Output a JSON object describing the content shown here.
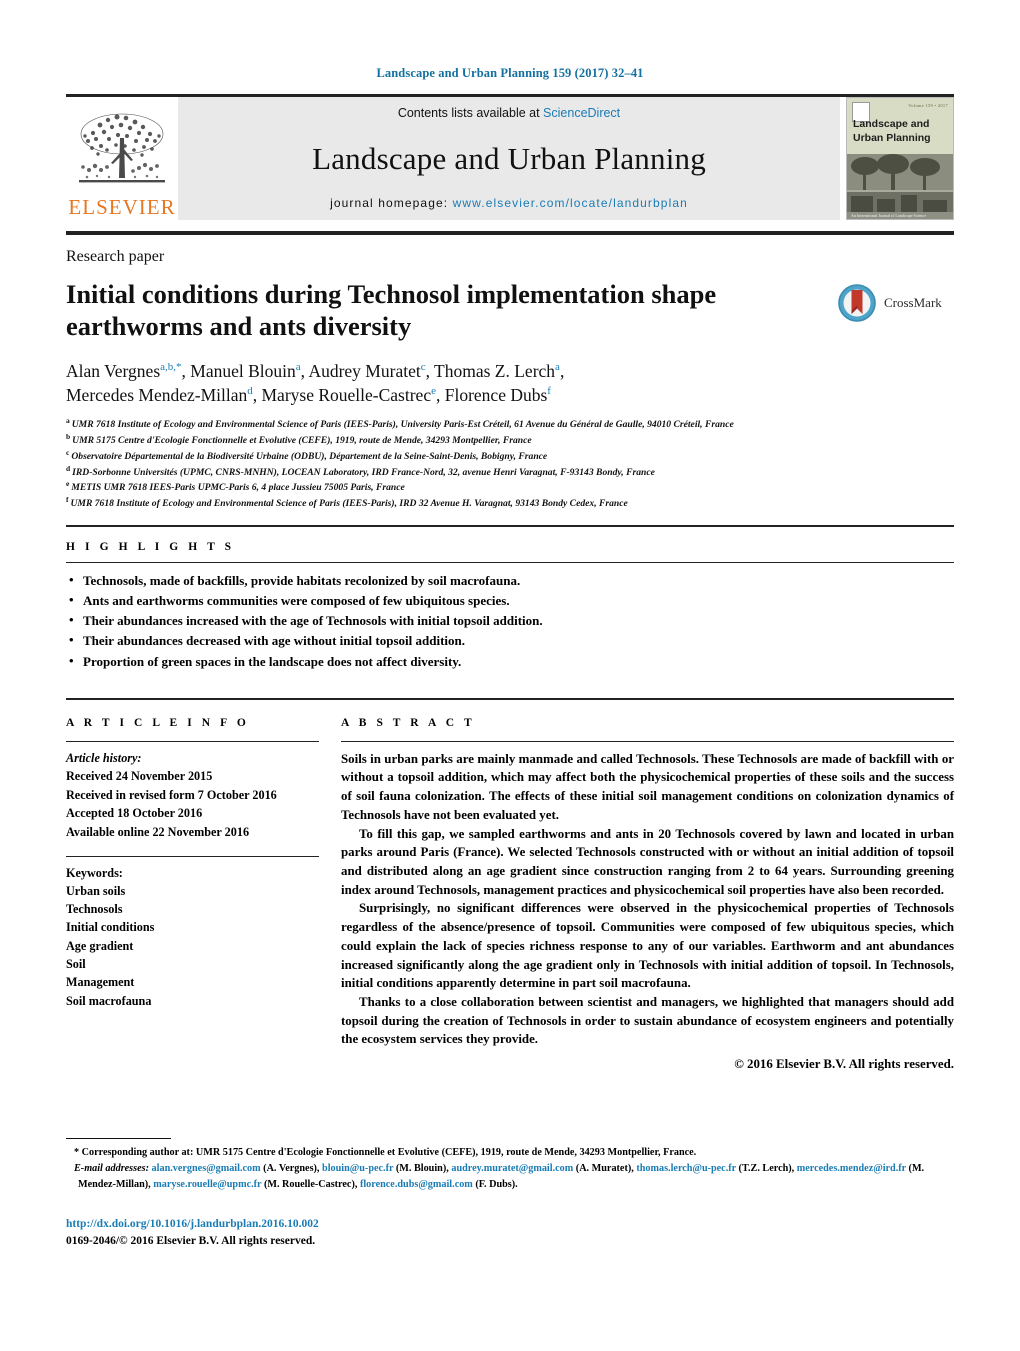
{
  "running_head": "Landscape and Urban Planning 159 (2017) 32–41",
  "masthead": {
    "publisher_logo_text": "ELSEVIER",
    "contents_prefix": "Contents lists available at ",
    "contents_link": "ScienceDirect",
    "journal_title": "Landscape and Urban Planning",
    "homepage_prefix": "journal homepage: ",
    "homepage_url": "www.elsevier.com/locate/landurbplan",
    "cover": {
      "line1": "Landscape and",
      "line2": "Urban Planning",
      "corner_note": "Volume 159 • 2017",
      "footer_note": "An International Journal of Landscape Science"
    }
  },
  "article": {
    "type_label": "Research paper",
    "title": "Initial conditions during Technosol implementation shape earthworms and ants diversity",
    "crossmark_label": "CrossMark",
    "authors_line1": "Alan Vergnes",
    "authors": [
      {
        "name": "Alan Vergnes",
        "marks": "a,b,*"
      },
      {
        "name": "Manuel Blouin",
        "marks": "a"
      },
      {
        "name": "Audrey Muratet",
        "marks": "c"
      },
      {
        "name": "Thomas Z. Lerch",
        "marks": "a"
      },
      {
        "name": "Mercedes Mendez-Millan",
        "marks": "d"
      },
      {
        "name": "Maryse Rouelle-Castrec",
        "marks": "e"
      },
      {
        "name": "Florence Dubs",
        "marks": "f"
      }
    ],
    "affiliations": [
      {
        "mark": "a",
        "text": "UMR 7618 Institute of Ecology and Environmental Science of Paris (IEES-Paris), University Paris-Est Créteil, 61 Avenue du Général de Gaulle, 94010 Créteil, France"
      },
      {
        "mark": "b",
        "text": "UMR 5175 Centre d'Ecologie Fonctionnelle et Evolutive (CEFE), 1919, route de Mende, 34293 Montpellier, France"
      },
      {
        "mark": "c",
        "text": "Observatoire Départemental de la Biodiversité Urbaine (ODBU), Département de la Seine-Saint-Denis, Bobigny, France"
      },
      {
        "mark": "d",
        "text": "IRD-Sorbonne Universités (UPMC, CNRS-MNHN), LOCEAN Laboratory, IRD France-Nord, 32, avenue Henri Varagnat, F-93143 Bondy, France"
      },
      {
        "mark": "e",
        "text": "METIS UMR 7618 IEES-Paris UPMC-Paris 6, 4 place Jussieu 75005 Paris, France"
      },
      {
        "mark": "f",
        "text": "UMR 7618 Institute of Ecology and Environmental Science of Paris (IEES-Paris), IRD 32 Avenue H. Varagnat, 93143 Bondy Cedex, France"
      }
    ]
  },
  "highlights": {
    "heading": "H I G H L I G H T S",
    "items": [
      "Technosols, made of backfills, provide habitats recolonized by soil macrofauna.",
      "Ants and earthworms communities were composed of few ubiquitous species.",
      "Their abundances increased with the age of Technosols with initial topsoil addition.",
      "Their abundances decreased with age without initial topsoil addition.",
      "Proportion of green spaces in the landscape does not affect diversity."
    ]
  },
  "article_info": {
    "heading": "A R T I C L E   I N F O",
    "history_label": "Article history:",
    "history": [
      "Received 24 November 2015",
      "Received in revised form 7 October 2016",
      "Accepted 18 October 2016",
      "Available online 22 November 2016"
    ],
    "keywords_label": "Keywords:",
    "keywords": [
      "Urban soils",
      "Technosols",
      "Initial conditions",
      "Age gradient",
      "Soil",
      "Management",
      "Soil macrofauna"
    ]
  },
  "abstract": {
    "heading": "A B S T R A C T",
    "paragraphs": [
      "Soils in urban parks are mainly manmade and called Technosols. These Technosols are made of backfill with or without a topsoil addition, which may affect both the physicochemical properties of these soils and the success of soil fauna colonization. The effects of these initial soil management conditions on colonization dynamics of Technosols have not been evaluated yet.",
      "To fill this gap, we sampled earthworms and ants in 20 Technosols covered by lawn and located in urban parks around Paris (France). We selected Technosols constructed with or without an initial addition of topsoil and distributed along an age gradient since construction ranging from 2 to 64 years. Surrounding greening index around Technosols, management practices and physicochemical soil properties have also been recorded.",
      "Surprisingly, no significant differences were observed in the physicochemical properties of Technosols regardless of the absence/presence of topsoil. Communities were composed of few ubiquitous species, which could explain the lack of species richness response to any of our variables. Earthworm and ant abundances increased significantly along the age gradient only in Technosols with initial addition of topsoil. In Technosols, initial conditions apparently determine in part soil macrofauna.",
      "Thanks to a close collaboration between scientist and managers, we highlighted that managers should add topsoil during the creation of Technosols in order to sustain abundance of ecosystem engineers and potentially the ecosystem services they provide."
    ],
    "copyright": "© 2016 Elsevier B.V. All rights reserved."
  },
  "footnotes": {
    "corresponding": "* Corresponding author at: UMR 5175 Centre d'Ecologie Fonctionnelle et Evolutive (CEFE), 1919, route de Mende, 34293 Montpellier, France.",
    "email_label": "E-mail addresses:",
    "emails": [
      {
        "address": "alan.vergnes@gmail.com",
        "person": "(A. Vergnes),"
      },
      {
        "address": "blouin@u-pec.fr",
        "person": "(M. Blouin),"
      },
      {
        "address": "audrey.muratet@gmail.com",
        "person": "(A. Muratet),"
      },
      {
        "address": "thomas.lerch@u-pec.fr",
        "person": "(T.Z. Lerch),"
      },
      {
        "address": "mercedes.mendez@ird.fr",
        "person": "(M. Mendez-Millan),"
      },
      {
        "address": "maryse.rouelle@upmc.fr",
        "person": "(M. Rouelle-Castrec),"
      },
      {
        "address": "florence.dubs@gmail.com",
        "person": "(F. Dubs)."
      }
    ]
  },
  "doi_block": {
    "doi_url": "http://dx.doi.org/10.1016/j.landurbplan.2016.10.002",
    "issn_line": "0169-2046/© 2016 Elsevier B.V. All rights reserved."
  },
  "colors": {
    "link_blue": "#1a7cb5",
    "elsevier_orange": "#E87722",
    "rule_dark": "#222222",
    "masthead_grey": "#e9e9e9"
  }
}
